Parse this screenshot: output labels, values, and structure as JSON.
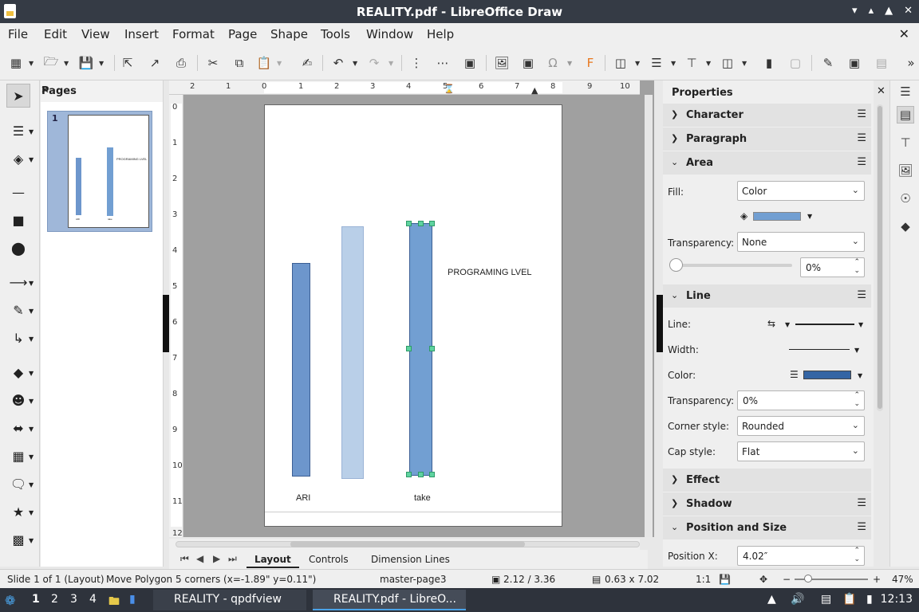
{
  "window": {
    "title": "REALITY.pdf - LibreOffice Draw"
  },
  "menu": [
    "File",
    "Edit",
    "View",
    "Insert",
    "Format",
    "Page",
    "Shape",
    "Tools",
    "Window",
    "Help"
  ],
  "pages_panel": {
    "title": "Pages",
    "thumb_number": "1",
    "thumb_text": "PROGRAMING LVEL",
    "thumb_label_1": "ARI",
    "thumb_label_2": "take"
  },
  "ruler": {
    "h": [
      "2",
      "1",
      "0",
      "1",
      "2",
      "3",
      "4",
      "5",
      "6",
      "7",
      "8",
      "9",
      "10"
    ],
    "v": [
      "0",
      "1",
      "2",
      "3",
      "4",
      "5",
      "6",
      "7",
      "8",
      "9",
      "10",
      "11",
      "12"
    ]
  },
  "canvas": {
    "text_programming": "PROGRAMING LVEL",
    "label_ari": "ARI",
    "label_take": "take",
    "colors": {
      "bar1": "#6d96cc",
      "bar2": "#b9cfe8",
      "bar3": "#729fd2"
    }
  },
  "tabs": [
    "Layout",
    "Controls",
    "Dimension Lines"
  ],
  "sidebar": {
    "title": "Properties",
    "sections": {
      "character": "Character",
      "paragraph": "Paragraph",
      "area": "Area",
      "line": "Line",
      "effect": "Effect",
      "shadow": "Shadow",
      "position_size": "Position and Size"
    },
    "area": {
      "fill_label": "Fill:",
      "fill_value": "Color",
      "fill_color": "#729fd2",
      "transparency_label": "Transparency:",
      "transparency_value": "None",
      "transparency_percent": "0%"
    },
    "line": {
      "line_label": "Line:",
      "width_label": "Width:",
      "color_label": "Color:",
      "line_color": "#3465a4",
      "transparency_label": "Transparency:",
      "transparency_value": "0%",
      "corner_label": "Corner style:",
      "corner_value": "Rounded",
      "cap_label": "Cap style:",
      "cap_value": "Flat"
    },
    "position": {
      "x_label": "Position X:",
      "x_value": "4.02″"
    }
  },
  "status": {
    "slide": "Slide 1 of 1 (Layout)",
    "action": "Move Polygon 5 corners (x=-1.89\" y=0.11\")",
    "master": "master-page3",
    "pos": "2.12 / 3.36",
    "size": "0.63 x 7.02",
    "scale": "1:1",
    "zoom": "47%"
  },
  "taskbar": {
    "workspaces": [
      "1",
      "2",
      "3",
      "4"
    ],
    "task1": "REALITY - qpdfview",
    "task2": "REALITY.pdf - LibreO...",
    "clock": "12:13"
  }
}
